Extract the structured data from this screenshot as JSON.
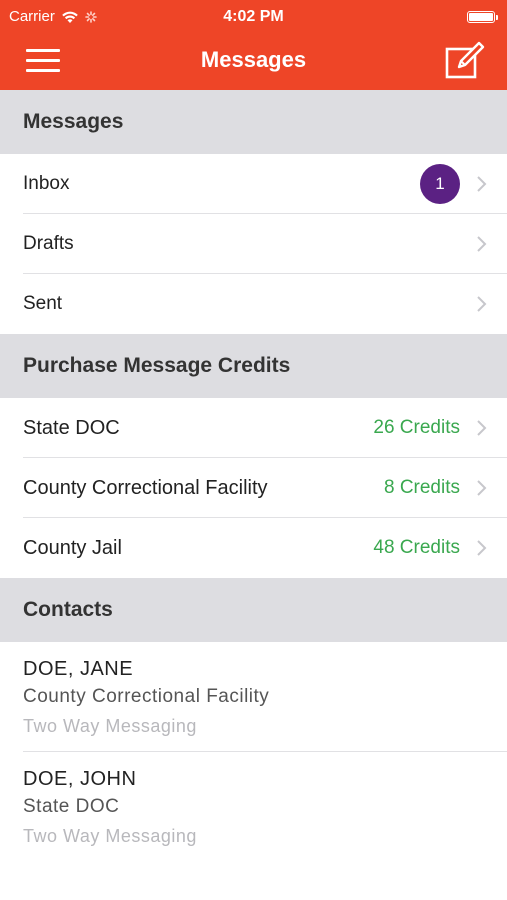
{
  "status_bar": {
    "carrier": "Carrier",
    "time": "4:02 PM"
  },
  "navbar": {
    "title": "Messages",
    "menu_icon": "hamburger-menu-icon",
    "compose_icon": "compose-icon"
  },
  "messages_section": {
    "header": "Messages",
    "items": [
      {
        "label": "Inbox",
        "badge": "1"
      },
      {
        "label": "Drafts"
      },
      {
        "label": "Sent"
      }
    ]
  },
  "purchase_section": {
    "header": "Purchase Message Credits",
    "items": [
      {
        "label": "State DOC",
        "credits": "26 Credits"
      },
      {
        "label": "County Correctional Facility",
        "credits": "8 Credits"
      },
      {
        "label": "County Jail",
        "credits": "48 Credits"
      }
    ]
  },
  "contacts_section": {
    "header": "Contacts",
    "items": [
      {
        "name": "DOE, JANE",
        "facility": "County Correctional Facility",
        "type": "Two Way Messaging"
      },
      {
        "name": "DOE, JOHN",
        "facility": "State DOC",
        "type": "Two Way Messaging"
      }
    ]
  },
  "colors": {
    "header_bg": "#ee4527",
    "badge_bg": "#5b2183",
    "credits_text": "#3aa84f",
    "section_bg": "#dddde1"
  }
}
